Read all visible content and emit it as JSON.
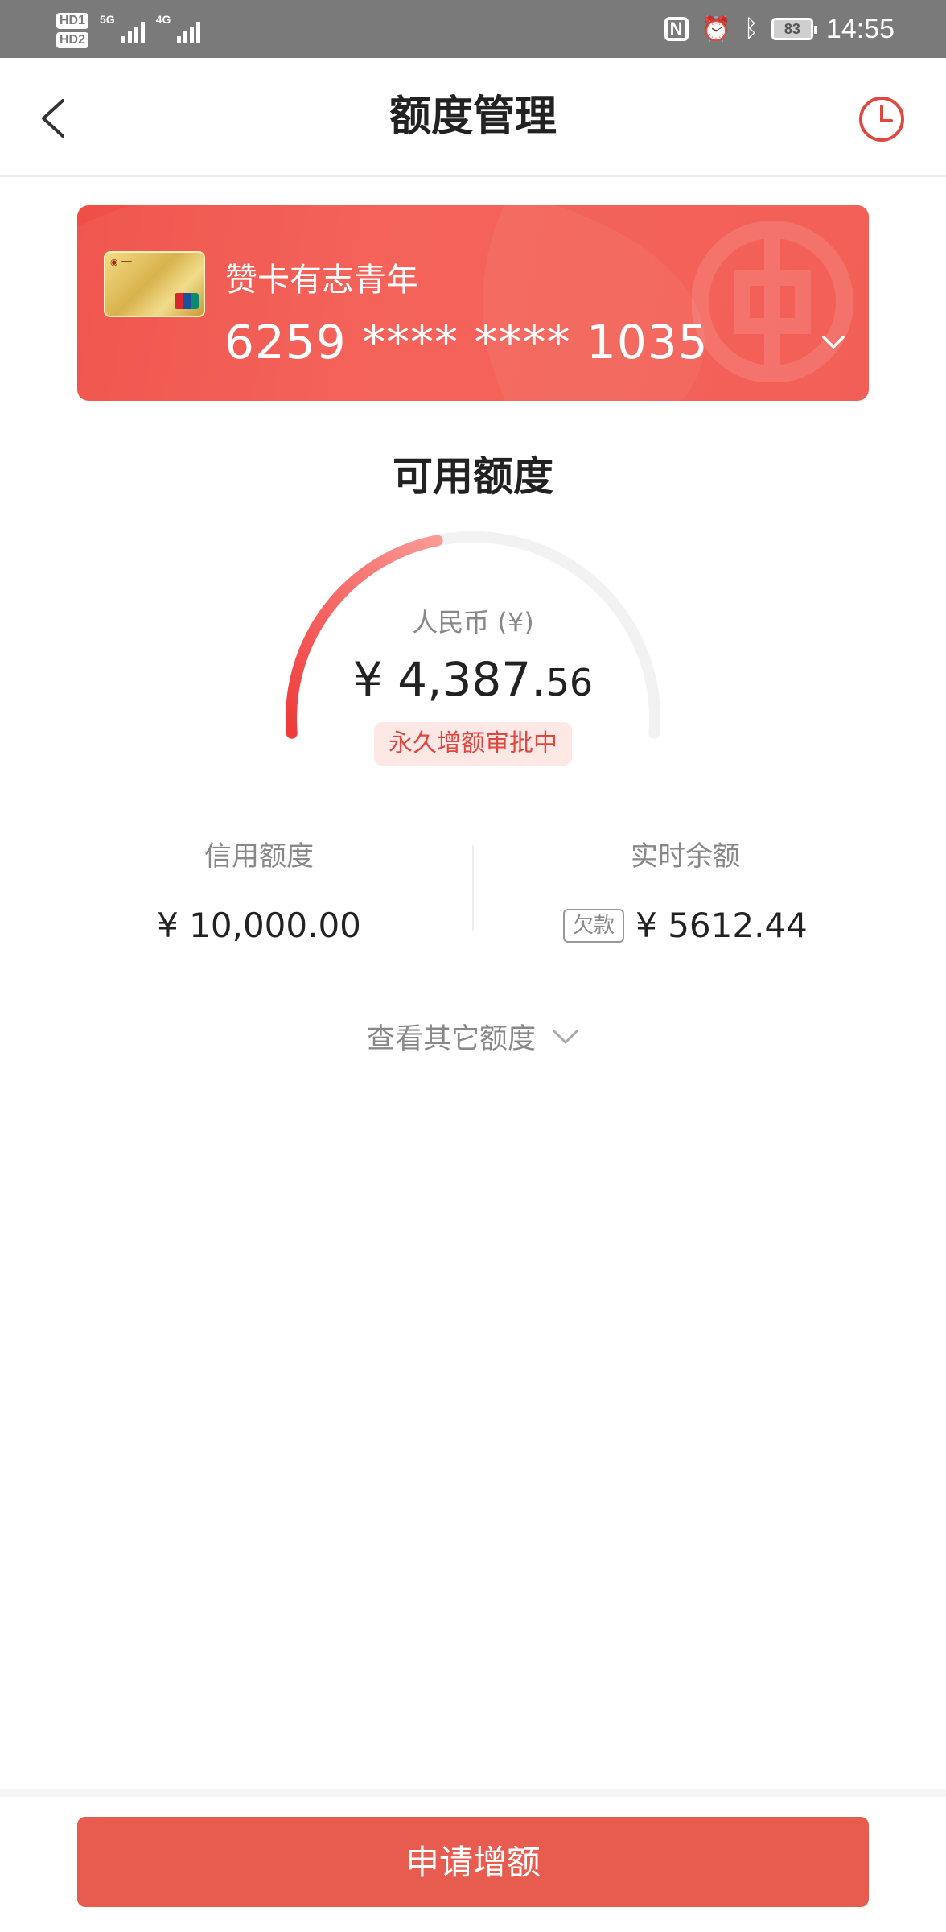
{
  "status_bar": {
    "sim1": "HD1",
    "sim2": "HD2",
    "network1": "5G",
    "network2": "4G",
    "battery": "83",
    "time": "14:55",
    "icons": [
      "nfc-icon",
      "alarm-icon",
      "bluetooth-icon",
      "battery-icon"
    ]
  },
  "nav": {
    "title": "额度管理",
    "back_icon": "back-arrow-icon",
    "history_icon": "clock-history-icon"
  },
  "card": {
    "name": "赞卡有志青年",
    "number": "6259 **** **** 1035",
    "expand_icon": "chevron-down-icon"
  },
  "available": {
    "title": "可用额度",
    "currency_label": "人民币 (¥)",
    "amount_main": "¥ 4,387.",
    "amount_cents": "56",
    "status": "永久增额审批中",
    "gauge_fraction": 0.44
  },
  "stats": {
    "credit_label": "信用额度",
    "credit_value": "¥ 10,000.00",
    "balance_label": "实时余额",
    "balance_tag": "欠款",
    "balance_value": "¥ 5612.44"
  },
  "more": {
    "label": "查看其它额度",
    "icon": "chevron-down-icon"
  },
  "action": {
    "apply_label": "申请增额"
  },
  "colors": {
    "primary": "#e85c50",
    "card_red": "#f2564c",
    "badge_bg": "#fde8e6",
    "badge_text": "#e0483f",
    "status_bar": "#7a7a7a"
  }
}
